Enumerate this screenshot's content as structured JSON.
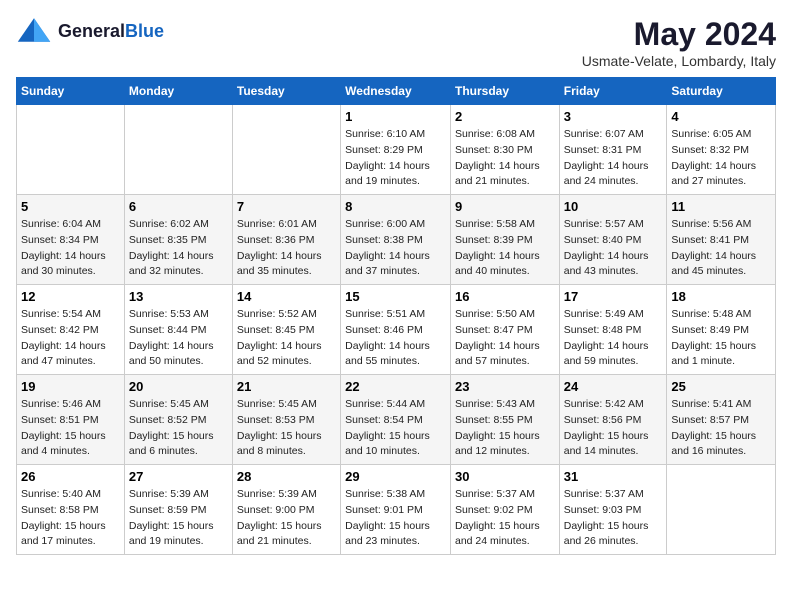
{
  "logo": {
    "general": "General",
    "blue": "Blue"
  },
  "title": {
    "month": "May 2024",
    "location": "Usmate-Velate, Lombardy, Italy"
  },
  "days_header": [
    "Sunday",
    "Monday",
    "Tuesday",
    "Wednesday",
    "Thursday",
    "Friday",
    "Saturday"
  ],
  "weeks": [
    {
      "cells": [
        {
          "day": null,
          "info": null
        },
        {
          "day": null,
          "info": null
        },
        {
          "day": null,
          "info": null
        },
        {
          "day": "1",
          "info": "Sunrise: 6:10 AM\nSunset: 8:29 PM\nDaylight: 14 hours\nand 19 minutes."
        },
        {
          "day": "2",
          "info": "Sunrise: 6:08 AM\nSunset: 8:30 PM\nDaylight: 14 hours\nand 21 minutes."
        },
        {
          "day": "3",
          "info": "Sunrise: 6:07 AM\nSunset: 8:31 PM\nDaylight: 14 hours\nand 24 minutes."
        },
        {
          "day": "4",
          "info": "Sunrise: 6:05 AM\nSunset: 8:32 PM\nDaylight: 14 hours\nand 27 minutes."
        }
      ]
    },
    {
      "cells": [
        {
          "day": "5",
          "info": "Sunrise: 6:04 AM\nSunset: 8:34 PM\nDaylight: 14 hours\nand 30 minutes."
        },
        {
          "day": "6",
          "info": "Sunrise: 6:02 AM\nSunset: 8:35 PM\nDaylight: 14 hours\nand 32 minutes."
        },
        {
          "day": "7",
          "info": "Sunrise: 6:01 AM\nSunset: 8:36 PM\nDaylight: 14 hours\nand 35 minutes."
        },
        {
          "day": "8",
          "info": "Sunrise: 6:00 AM\nSunset: 8:38 PM\nDaylight: 14 hours\nand 37 minutes."
        },
        {
          "day": "9",
          "info": "Sunrise: 5:58 AM\nSunset: 8:39 PM\nDaylight: 14 hours\nand 40 minutes."
        },
        {
          "day": "10",
          "info": "Sunrise: 5:57 AM\nSunset: 8:40 PM\nDaylight: 14 hours\nand 43 minutes."
        },
        {
          "day": "11",
          "info": "Sunrise: 5:56 AM\nSunset: 8:41 PM\nDaylight: 14 hours\nand 45 minutes."
        }
      ]
    },
    {
      "cells": [
        {
          "day": "12",
          "info": "Sunrise: 5:54 AM\nSunset: 8:42 PM\nDaylight: 14 hours\nand 47 minutes."
        },
        {
          "day": "13",
          "info": "Sunrise: 5:53 AM\nSunset: 8:44 PM\nDaylight: 14 hours\nand 50 minutes."
        },
        {
          "day": "14",
          "info": "Sunrise: 5:52 AM\nSunset: 8:45 PM\nDaylight: 14 hours\nand 52 minutes."
        },
        {
          "day": "15",
          "info": "Sunrise: 5:51 AM\nSunset: 8:46 PM\nDaylight: 14 hours\nand 55 minutes."
        },
        {
          "day": "16",
          "info": "Sunrise: 5:50 AM\nSunset: 8:47 PM\nDaylight: 14 hours\nand 57 minutes."
        },
        {
          "day": "17",
          "info": "Sunrise: 5:49 AM\nSunset: 8:48 PM\nDaylight: 14 hours\nand 59 minutes."
        },
        {
          "day": "18",
          "info": "Sunrise: 5:48 AM\nSunset: 8:49 PM\nDaylight: 15 hours\nand 1 minute."
        }
      ]
    },
    {
      "cells": [
        {
          "day": "19",
          "info": "Sunrise: 5:46 AM\nSunset: 8:51 PM\nDaylight: 15 hours\nand 4 minutes."
        },
        {
          "day": "20",
          "info": "Sunrise: 5:45 AM\nSunset: 8:52 PM\nDaylight: 15 hours\nand 6 minutes."
        },
        {
          "day": "21",
          "info": "Sunrise: 5:45 AM\nSunset: 8:53 PM\nDaylight: 15 hours\nand 8 minutes."
        },
        {
          "day": "22",
          "info": "Sunrise: 5:44 AM\nSunset: 8:54 PM\nDaylight: 15 hours\nand 10 minutes."
        },
        {
          "day": "23",
          "info": "Sunrise: 5:43 AM\nSunset: 8:55 PM\nDaylight: 15 hours\nand 12 minutes."
        },
        {
          "day": "24",
          "info": "Sunrise: 5:42 AM\nSunset: 8:56 PM\nDaylight: 15 hours\nand 14 minutes."
        },
        {
          "day": "25",
          "info": "Sunrise: 5:41 AM\nSunset: 8:57 PM\nDaylight: 15 hours\nand 16 minutes."
        }
      ]
    },
    {
      "cells": [
        {
          "day": "26",
          "info": "Sunrise: 5:40 AM\nSunset: 8:58 PM\nDaylight: 15 hours\nand 17 minutes."
        },
        {
          "day": "27",
          "info": "Sunrise: 5:39 AM\nSunset: 8:59 PM\nDaylight: 15 hours\nand 19 minutes."
        },
        {
          "day": "28",
          "info": "Sunrise: 5:39 AM\nSunset: 9:00 PM\nDaylight: 15 hours\nand 21 minutes."
        },
        {
          "day": "29",
          "info": "Sunrise: 5:38 AM\nSunset: 9:01 PM\nDaylight: 15 hours\nand 23 minutes."
        },
        {
          "day": "30",
          "info": "Sunrise: 5:37 AM\nSunset: 9:02 PM\nDaylight: 15 hours\nand 24 minutes."
        },
        {
          "day": "31",
          "info": "Sunrise: 5:37 AM\nSunset: 9:03 PM\nDaylight: 15 hours\nand 26 minutes."
        },
        {
          "day": null,
          "info": null
        }
      ]
    }
  ]
}
